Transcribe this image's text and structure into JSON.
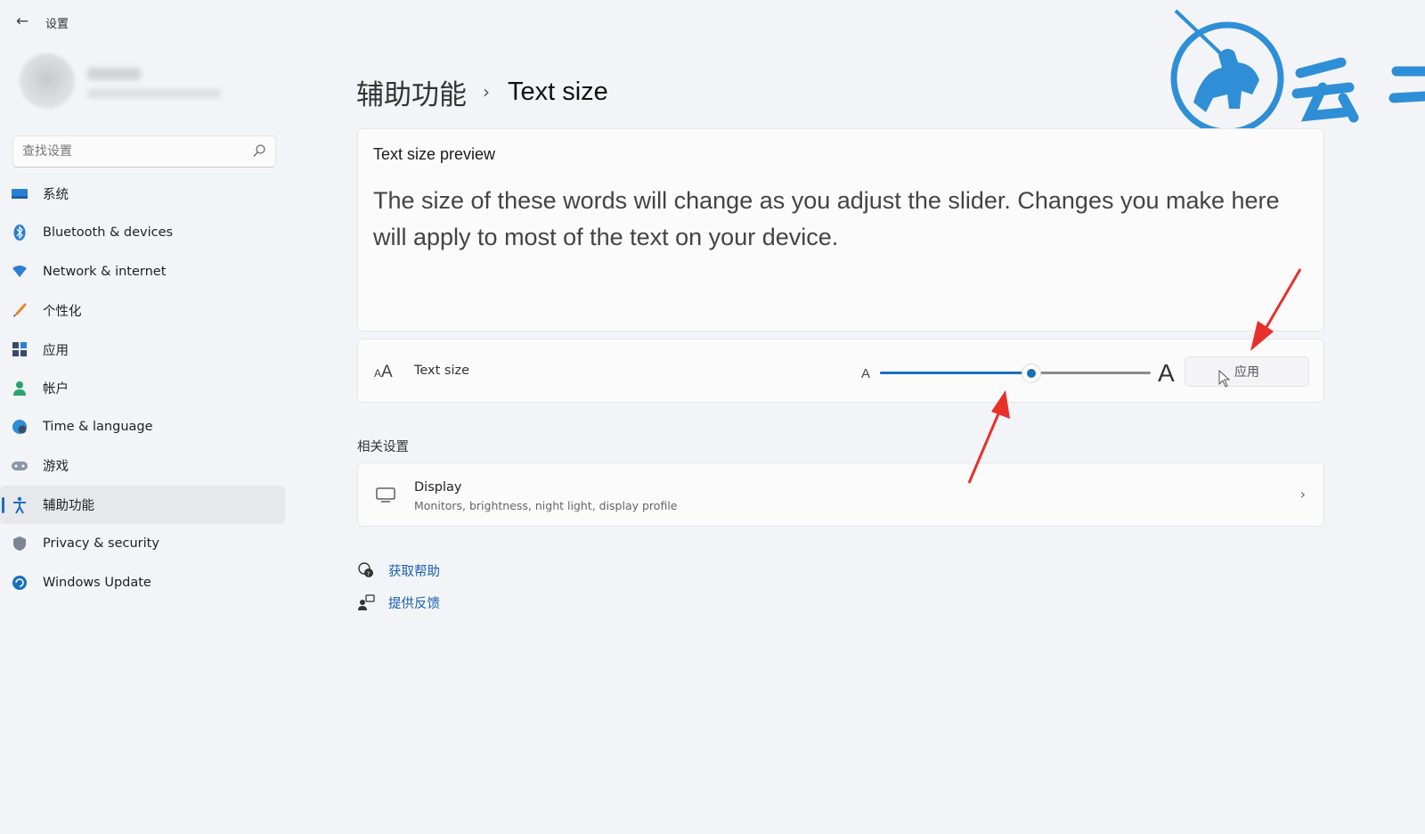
{
  "window": {
    "title": "设置"
  },
  "colors": {
    "accent": "#1a6fbf",
    "link": "#1a5fb4",
    "annotation_arrow": "#e8302a",
    "logo_blue": "#2e8fd6"
  },
  "search": {
    "placeholder": "查找设置",
    "icon": "search-icon"
  },
  "sidebar": {
    "items": [
      {
        "label": "系统",
        "icon": "system-icon"
      },
      {
        "label": "Bluetooth & devices",
        "icon": "bluetooth-icon"
      },
      {
        "label": "Network & internet",
        "icon": "wifi-icon"
      },
      {
        "label": "个性化",
        "icon": "brush-icon"
      },
      {
        "label": "应用",
        "icon": "apps-icon"
      },
      {
        "label": "帐户",
        "icon": "account-icon"
      },
      {
        "label": "Time & language",
        "icon": "globe-clock-icon"
      },
      {
        "label": "游戏",
        "icon": "gamepad-icon"
      },
      {
        "label": "辅助功能",
        "icon": "accessibility-icon",
        "active": true
      },
      {
        "label": "Privacy & security",
        "icon": "shield-icon"
      },
      {
        "label": "Windows Update",
        "icon": "update-icon"
      }
    ]
  },
  "breadcrumb": {
    "parent": "辅助功能",
    "separator": "›",
    "current": "Text size"
  },
  "preview": {
    "title": "Text size preview",
    "text": "The size of these words will change as you adjust the slider. Changes you make here will apply to most of the text on your device."
  },
  "text_size": {
    "label": "Text size",
    "min_glyph": "A",
    "max_glyph": "A",
    "slider_level": 0.56,
    "apply_label": "应用"
  },
  "related": {
    "title": "相关设置",
    "display": {
      "title": "Display",
      "subtitle": "Monitors, brightness, night light, display profile"
    }
  },
  "links": {
    "help": "获取帮助",
    "feedback": "提供反馈"
  }
}
